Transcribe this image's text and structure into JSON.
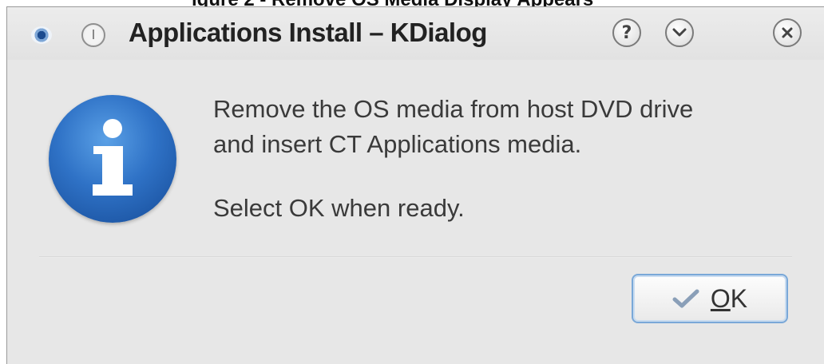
{
  "window": {
    "title": "Applications Install – KDialog"
  },
  "titlebar_controls": {
    "help": "?",
    "shade": "⌄",
    "close": "×"
  },
  "dialog": {
    "message_line1": "Remove the OS media from host DVD drive",
    "message_line2": "and insert CT Applications media.",
    "message_line3": "Select OK when ready.",
    "icon": "information-icon"
  },
  "buttons": {
    "ok_label": "OK",
    "ok_icon": "checkmark-icon",
    "accent": "#7aa8d8"
  },
  "colors": {
    "info_blue": "#2f72c6",
    "window_bg": "#e7e7e7"
  }
}
